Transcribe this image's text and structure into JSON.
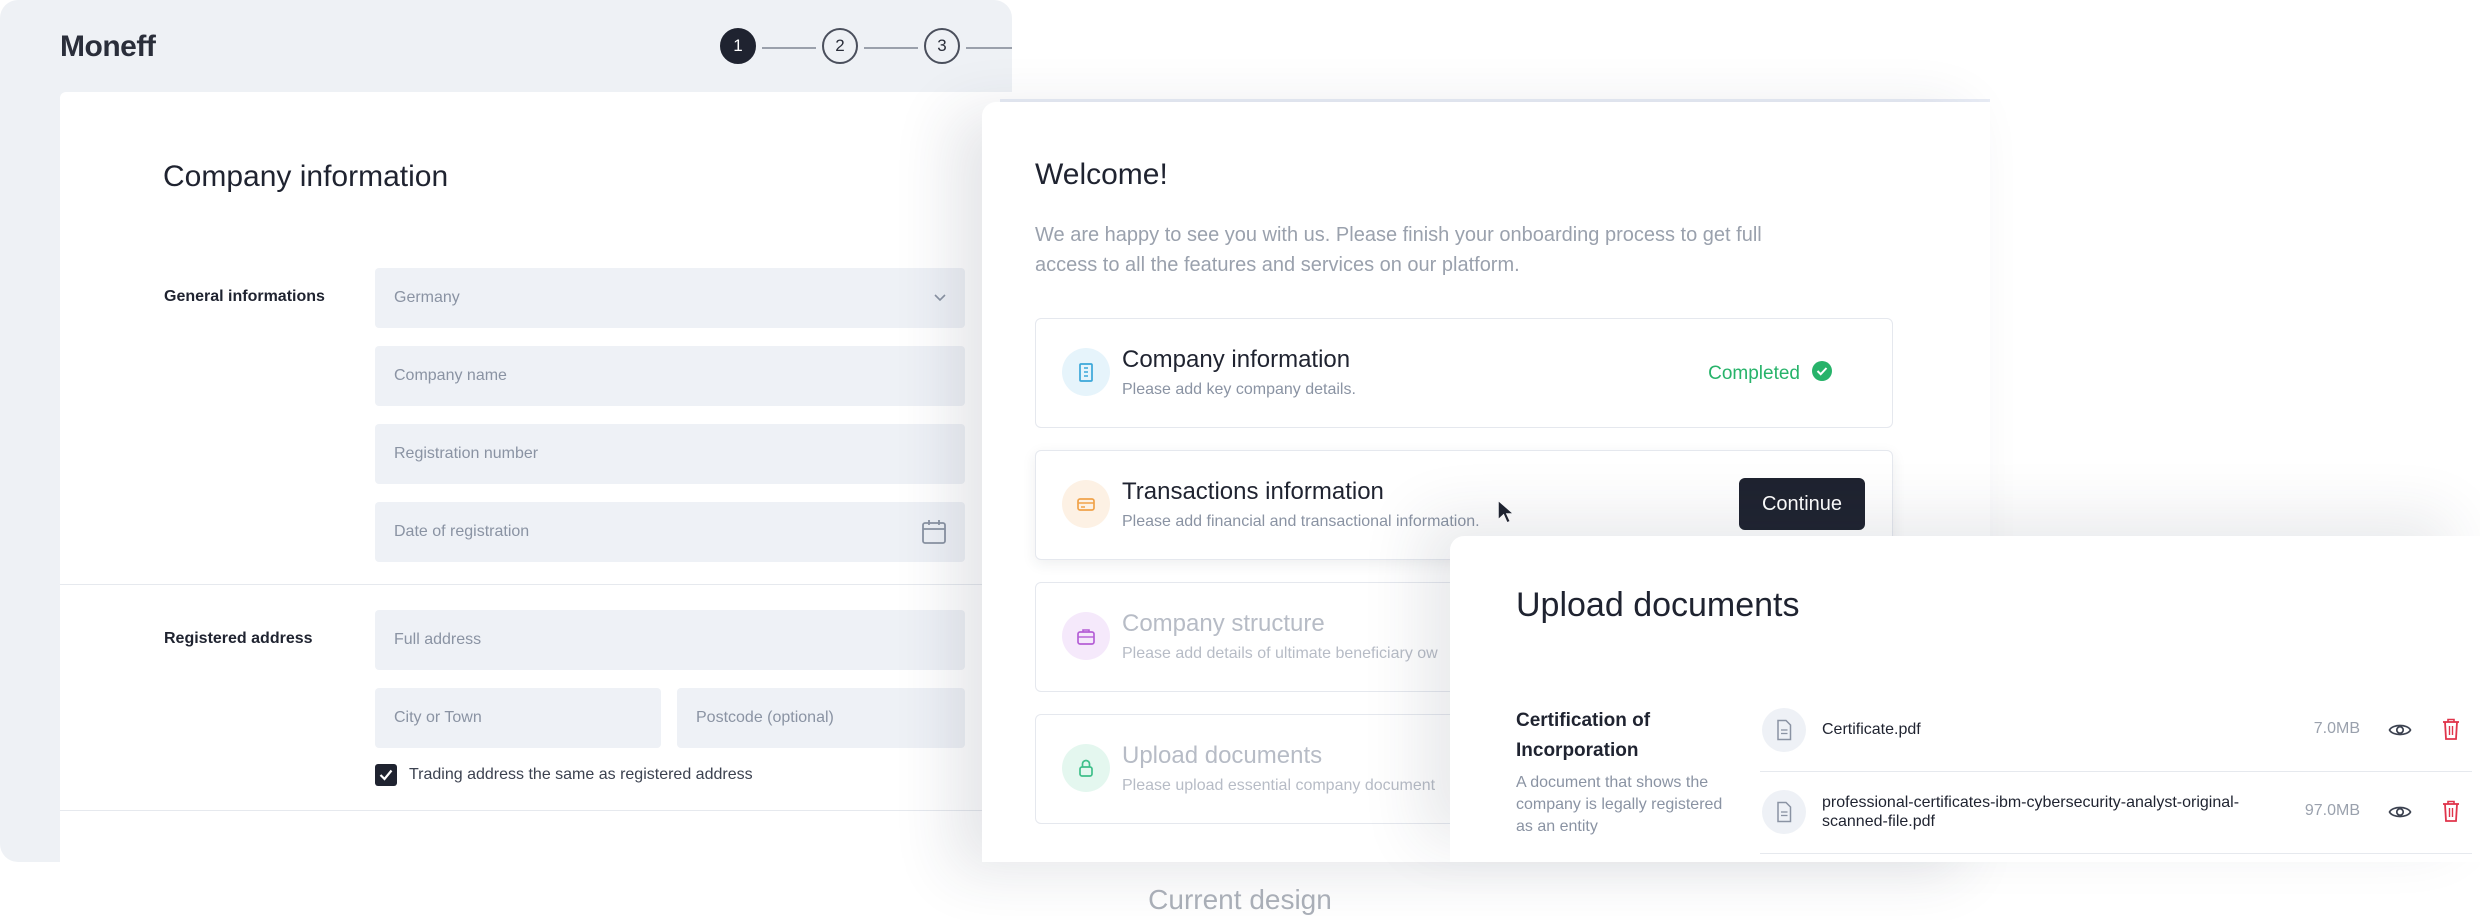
{
  "app": {
    "logo": "Moneff"
  },
  "stepper": {
    "steps": [
      "1",
      "2",
      "3"
    ],
    "active_step": "1"
  },
  "company_form": {
    "title": "Company information",
    "general": {
      "label": "General informations",
      "country_value": "Germany",
      "company_name_placeholder": "Company name",
      "registration_number_placeholder": "Registration number",
      "date_placeholder": "Date of registration"
    },
    "address": {
      "label": "Registered address",
      "full_address_placeholder": "Full address",
      "city_placeholder": "City or Town",
      "postcode_placeholder": "Postcode (optional)",
      "trading_same_label": "Trading address the same as registered address",
      "trading_same_checked": true
    }
  },
  "welcome": {
    "title": "Welcome!",
    "subtitle": "We are happy to see you with us. Please finish your onboarding process to get full access to all the features and services on our platform.",
    "tasks": [
      {
        "title": "Company information",
        "description": "Please add key company details.",
        "status": "Completed",
        "icon": "building-icon",
        "color": "#3aa7d9"
      },
      {
        "title": "Transactions information",
        "description": "Please add financial and transactional information.",
        "action": "Continue",
        "icon": "card-icon",
        "color": "#f0a24a"
      },
      {
        "title": "Company structure",
        "description": "Please add details of ultimate beneficiary ow",
        "icon": "briefcase-icon",
        "color": "#b55fd6"
      },
      {
        "title": "Upload documents",
        "description": "Please upload essential company document",
        "icon": "lock-icon",
        "color": "#3fbf8a"
      }
    ]
  },
  "upload": {
    "title": "Upload documents",
    "section_label": "Certification of Incorporation",
    "section_description": "A document that shows the company is legally registered as an entity",
    "files": [
      {
        "name": "Certificate.pdf",
        "size": "7.0MB"
      },
      {
        "name": "professional-certificates-ibm-cybersecurity-analyst-original-scanned-file.pdf",
        "size": "97.0MB"
      }
    ]
  },
  "caption": "Current design",
  "colors": {
    "primary": "#1f2330",
    "success": "#27b36a",
    "danger": "#e0344b",
    "field_bg": "#eef1f6"
  }
}
